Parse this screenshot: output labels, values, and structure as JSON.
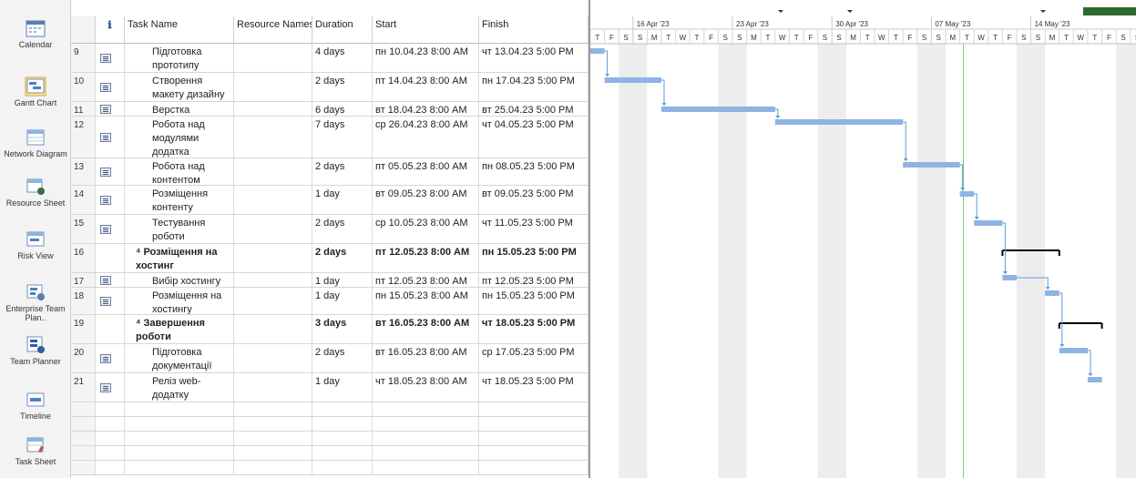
{
  "views": [
    {
      "id": "calendar",
      "label": "Calendar",
      "icon": "calendar-icon"
    },
    {
      "id": "gantt",
      "label": "Gantt Chart",
      "icon": "gantt-chart-icon",
      "active": true
    },
    {
      "id": "network",
      "label": "Network Diagram",
      "icon": "network-diagram-icon"
    },
    {
      "id": "resource",
      "label": "Resource Sheet",
      "icon": "resource-sheet-icon"
    },
    {
      "id": "risk",
      "label": "Risk View",
      "icon": "risk-view-icon"
    },
    {
      "id": "enterprise",
      "label": "Enterprise Team Plan..",
      "icon": "enterprise-team-planner-icon"
    },
    {
      "id": "team",
      "label": "Team Planner",
      "icon": "team-planner-icon"
    },
    {
      "id": "timeline",
      "label": "Timeline",
      "icon": "timeline-icon"
    },
    {
      "id": "tasksheet",
      "label": "Task Sheet",
      "icon": "task-sheet-icon"
    }
  ],
  "columns": {
    "indicator": "ℹ",
    "task_name": "Task Name",
    "resource_names": "Resource Names",
    "duration": "Duration",
    "start": "Start",
    "finish": "Finish"
  },
  "tasks": [
    {
      "id": "9",
      "name": "Підготовка прототипу",
      "summary": false,
      "duration": "4 days",
      "start": "пн 10.04.23 8:00 AM",
      "finish": "чт 13.04.23 5:00 PM"
    },
    {
      "id": "10",
      "name": "Створення макету дизайну",
      "summary": false,
      "duration": "2 days",
      "start": "пт 14.04.23 8:00 AM",
      "finish": "пн 17.04.23 5:00 PM"
    },
    {
      "id": "11",
      "name": "Верстка",
      "summary": false,
      "duration": "6 days",
      "start": "вт 18.04.23 8:00 AM",
      "finish": "вт 25.04.23 5:00 PM"
    },
    {
      "id": "12",
      "name": "Робота над модулями додатка",
      "summary": false,
      "duration": "7 days",
      "start": "ср 26.04.23 8:00 AM",
      "finish": "чт 04.05.23 5:00 PM"
    },
    {
      "id": "13",
      "name": "Робота над контентом",
      "summary": false,
      "duration": "2 days",
      "start": "пт 05.05.23 8:00 AM",
      "finish": "пн 08.05.23 5:00 PM"
    },
    {
      "id": "14",
      "name": "Розміщення контенту",
      "summary": false,
      "duration": "1 day",
      "start": "вт 09.05.23 8:00 AM",
      "finish": "вт 09.05.23 5:00 PM"
    },
    {
      "id": "15",
      "name": "Тестування роботи",
      "summary": false,
      "duration": "2 days",
      "start": "ср 10.05.23 8:00 AM",
      "finish": "чт 11.05.23 5:00 PM"
    },
    {
      "id": "16",
      "name": "⁴ Розміщення на хостинг",
      "summary": true,
      "duration": "2 days",
      "start": "пт 12.05.23 8:00 AM",
      "finish": "пн 15.05.23 5:00 PM"
    },
    {
      "id": "17",
      "name": "Вибір хостингу",
      "summary": false,
      "duration": "1 day",
      "start": "пт 12.05.23 8:00 AM",
      "finish": "пт 12.05.23 5:00 PM"
    },
    {
      "id": "18",
      "name": "Розміщення на хостингу",
      "summary": false,
      "duration": "1 day",
      "start": "пн 15.05.23 8:00 AM",
      "finish": "пн 15.05.23 5:00 PM"
    },
    {
      "id": "19",
      "name": "⁴ Завершення роботи",
      "summary": true,
      "duration": "3 days",
      "start": "вт 16.05.23 8:00 AM",
      "finish": "чт 18.05.23 5:00 PM"
    },
    {
      "id": "20",
      "name": "Підготовка документації",
      "summary": false,
      "duration": "2 days",
      "start": "вт 16.05.23 8:00 AM",
      "finish": "ср 17.05.23 5:00 PM"
    },
    {
      "id": "21",
      "name": "Реліз web-додатку",
      "summary": false,
      "duration": "1 day",
      "start": "чт 18.05.23 8:00 AM",
      "finish": "чт 18.05.23 5:00 PM"
    }
  ],
  "timescale": {
    "weeks": [
      "16 Apr '23",
      "23 Apr '23",
      "30 Apr '23",
      "07 May '23",
      "14 May '23"
    ],
    "day_letters": [
      "T",
      "F",
      "S",
      "S",
      "M",
      "T",
      "W",
      "T",
      "F",
      "S",
      "S",
      "M",
      "T",
      "W",
      "T",
      "F",
      "S",
      "S",
      "M",
      "T",
      "W",
      "T",
      "F",
      "S",
      "S",
      "M",
      "T",
      "W",
      "T",
      "F",
      "S",
      "S",
      "M",
      "T",
      "W",
      "T",
      "F",
      "S",
      "S"
    ]
  },
  "colors": {
    "task_bar": "#8db4e2",
    "weekend_shade": "#ededed",
    "link_arrow": "#5b9bd5",
    "summary_bar": "#000000",
    "today_line": "#7ec27e",
    "green_indicator": "#2e6b2e"
  }
}
